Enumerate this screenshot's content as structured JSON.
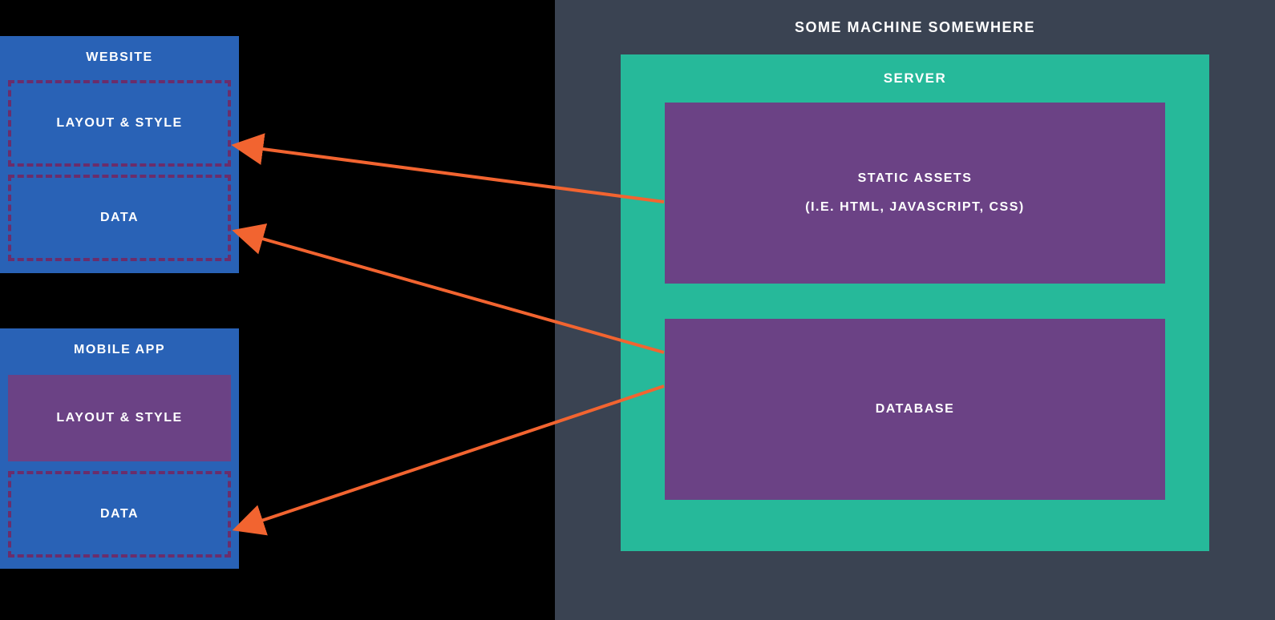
{
  "left": {
    "website": {
      "title": "WEBSITE",
      "layout_style": "LAYOUT & STYLE",
      "data": "DATA"
    },
    "mobile_app": {
      "title": "MOBILE APP",
      "layout_style": "LAYOUT & STYLE",
      "data": "DATA"
    }
  },
  "right": {
    "machine_title": "SOME MACHINE SOMEWHERE",
    "server_title": "SERVER",
    "static_assets": {
      "line1": "STATIC ASSETS",
      "line2": "(I.E. HTML, JAVASCRIPT, CSS)"
    },
    "database": "DATABASE"
  },
  "colors": {
    "blue": "#2962b6",
    "purple": "#6b4285",
    "dark_purple_dash": "#6b2d6b",
    "teal": "#26b99a",
    "dark_gray": "#3a4352",
    "orange": "#f26430"
  }
}
